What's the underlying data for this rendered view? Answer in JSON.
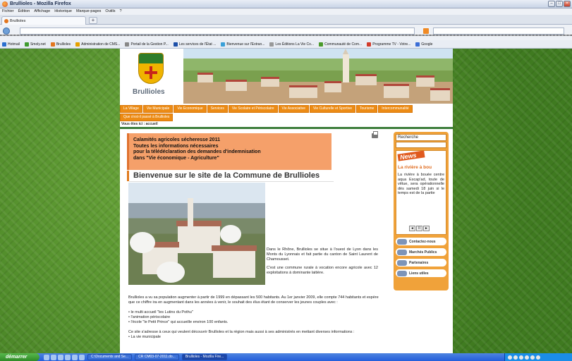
{
  "window": {
    "title": "Brullioles - Mozilla Firefox",
    "minimize": "–",
    "maximize": "□",
    "close": "×"
  },
  "menu": [
    "Fichier",
    "Édition",
    "Affichage",
    "Historique",
    "Marque-pages",
    "Outils",
    "?"
  ],
  "tab": {
    "label": "Brullioles",
    "new_tab": "+"
  },
  "bookmarks": [
    {
      "label": "Hotmail",
      "color": "#2a6fcf"
    },
    {
      "label": "Smoly.net",
      "color": "#3f9b2f"
    },
    {
      "label": "Brullioles",
      "color": "#e2761f"
    },
    {
      "label": "Administration de CMS...",
      "color": "#e6a100"
    },
    {
      "label": "Portail de la Gestion P...",
      "color": "#888888"
    },
    {
      "label": "Les services de l'État ...",
      "color": "#1d4fa8"
    },
    {
      "label": "Bienvenue sur l'Extran...",
      "color": "#3aa0d8"
    },
    {
      "label": "Les Éditions La Vie Co...",
      "color": "#999999"
    },
    {
      "label": "Communauté de Com...",
      "color": "#4a9a2a"
    },
    {
      "label": "Programme TV - Votre...",
      "color": "#d23b2b"
    },
    {
      "label": "Google",
      "color": "#3b6ed6"
    }
  ],
  "site": {
    "logo_name": "Brullioles",
    "nav": [
      "La Village",
      "Vie Municipale",
      "Vie Economique",
      "Services",
      "Vie Scolaire et Périscolaire",
      "Vie Associative",
      "Vie Culturelle et Sportive",
      "Tourisme",
      "Intercommunalité",
      "Que s'est-il passé à Brullioles"
    ],
    "breadcrumb": "Vous êtes ici : accueil",
    "alert": [
      "Calamités agricoles sécheresse 2011",
      "Toutes les informations nécessaires",
      "pour la télédéclaration des demandes d'indemnisation",
      "dans \"Vie économique - Agriculture\""
    ],
    "welcome": "Bienvenue sur le site de la Commune de Brullioles",
    "desc": [
      "Dans le Rhône, Brullioles se situe à l'ouest de Lyon dans les Monts du Lyonnais et fait partie du canton de Saint Laurent de Chamousset.",
      "C'est une commune rurale à vocation encore agricole avec 12 exploitations à dominante laitière."
    ],
    "body": [
      "Brullioles a vu sa population augmenter à partir de 1999 en dépassant les 500 habitants. Au 1er janvier 2009, elle compte 744 habitants et espère que ce chiffre ira en augmentant dans les années à venir, le souhait des élus étant de conserver les jeunes couples avec :",
      "• le multi accueil \"les Lutins du Pothu\"",
      "• l'animation périscolaire",
      "• l'école \"le Petit Prince\" qui accueille environ 100 enfants.",
      "Ce site s'adresse à ceux qui veulent découvrir Brullioles et la région mais aussi à ses administrés en mettant diverses informations :",
      "• La vie municipale"
    ],
    "sidebar": {
      "search_label": "Recherche",
      "news_badge": "News",
      "news_title": "La rivière à bou",
      "news_text": "La rivière à bouée centre aqua Escap'ad, toute de vêtue, sera opérationnelle dès samedi 18 juin si le temps est de la partie",
      "pager": [
        "◄",
        "II",
        "►"
      ],
      "buttons": [
        "Contactez-nous",
        "Marchés Publics",
        "Partenaires",
        "Liens utiles"
      ]
    }
  },
  "taskbar": {
    "start": "démarrer",
    "tasks": [
      "C:\\Documents and Se...",
      "CR CM03-07-2011.do...",
      "Brullioles - Mozilla Fire..."
    ]
  }
}
